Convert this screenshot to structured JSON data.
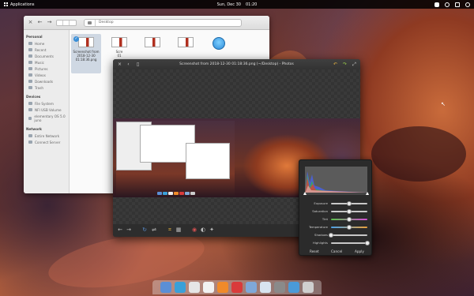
{
  "top_panel": {
    "applications_label": "Applications",
    "date": "Sun, Dec 30",
    "time": "01:20",
    "indicators": [
      "network-icon",
      "sound-icon",
      "notification-icon",
      "power-icon"
    ]
  },
  "files": {
    "path": "Desktop",
    "sidebar": {
      "personal_header": "Personal",
      "personal": [
        "Home",
        "Recent",
        "Documents",
        "Music",
        "Pictures",
        "Videos",
        "Downloads",
        "Trash"
      ],
      "devices_header": "Devices",
      "devices": [
        "File System",
        "NFI USB Volume",
        "elementary OS 5.0 juno"
      ],
      "network_header": "Network",
      "network": [
        "Entire Network",
        "Connect Server"
      ]
    },
    "selected_file": {
      "name": "Screenshot from 2018-12-30 01:18:36.png"
    },
    "partial_label": "Scre",
    "partial_label2": "01"
  },
  "photos": {
    "title": "Screenshot from 2018-12-30 01:18:36.png (~/Desktop) - Photos"
  },
  "adjust": {
    "sliders": [
      {
        "label": "Exposure",
        "value": 0.5,
        "track": "#c8c8c8"
      },
      {
        "label": "Saturation",
        "value": 0.5,
        "track": "#c8c8c8"
      },
      {
        "label": "Tint",
        "value": 0.5,
        "track": "linear-gradient(90deg,#59c24a,#d44bd4)"
      },
      {
        "label": "Temperature",
        "value": 0.5,
        "track": "linear-gradient(90deg,#4aa0e8,#e8a03a)"
      },
      {
        "label": "Shadows",
        "value": 0.0,
        "track": "#c8c8c8"
      },
      {
        "label": "Highlights",
        "value": 1.0,
        "track": "#c8c8c8"
      }
    ],
    "reset_label": "Reset",
    "cancel_label": "Cancel",
    "apply_label": "Apply"
  },
  "dock": {
    "apps": [
      {
        "name": "multitasking-view-icon",
        "color": "#5b8fd6"
      },
      {
        "name": "web-browser-icon",
        "color": "#3aa0d8"
      },
      {
        "name": "mail-icon",
        "color": "#e6e6e6"
      },
      {
        "name": "calendar-icon",
        "color": "#f2f2f2"
      },
      {
        "name": "music-icon",
        "color": "#f08a2a"
      },
      {
        "name": "videos-icon",
        "color": "#d93b3b"
      },
      {
        "name": "files-icon",
        "color": "#7fa8d8"
      },
      {
        "name": "photos-icon",
        "color": "#d8e4f0"
      },
      {
        "name": "system-settings-icon",
        "color": "#8a8a8a"
      },
      {
        "name": "appcenter-icon",
        "color": "#4a9ad8"
      },
      {
        "name": "terminal-icon",
        "color": "#cfcfcf"
      }
    ]
  }
}
